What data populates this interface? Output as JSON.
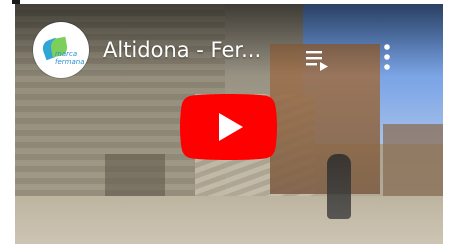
{
  "video": {
    "title": "Altidona - Fer...",
    "channel_avatar_text": "marca fermana",
    "icons": {
      "queue": "playlist-add-icon",
      "more": "more-vert-icon",
      "play": "youtube-play-icon"
    },
    "colors": {
      "play_red": "#ff0000",
      "play_triangle": "#ffffff",
      "title_text": "#ffffff"
    }
  }
}
